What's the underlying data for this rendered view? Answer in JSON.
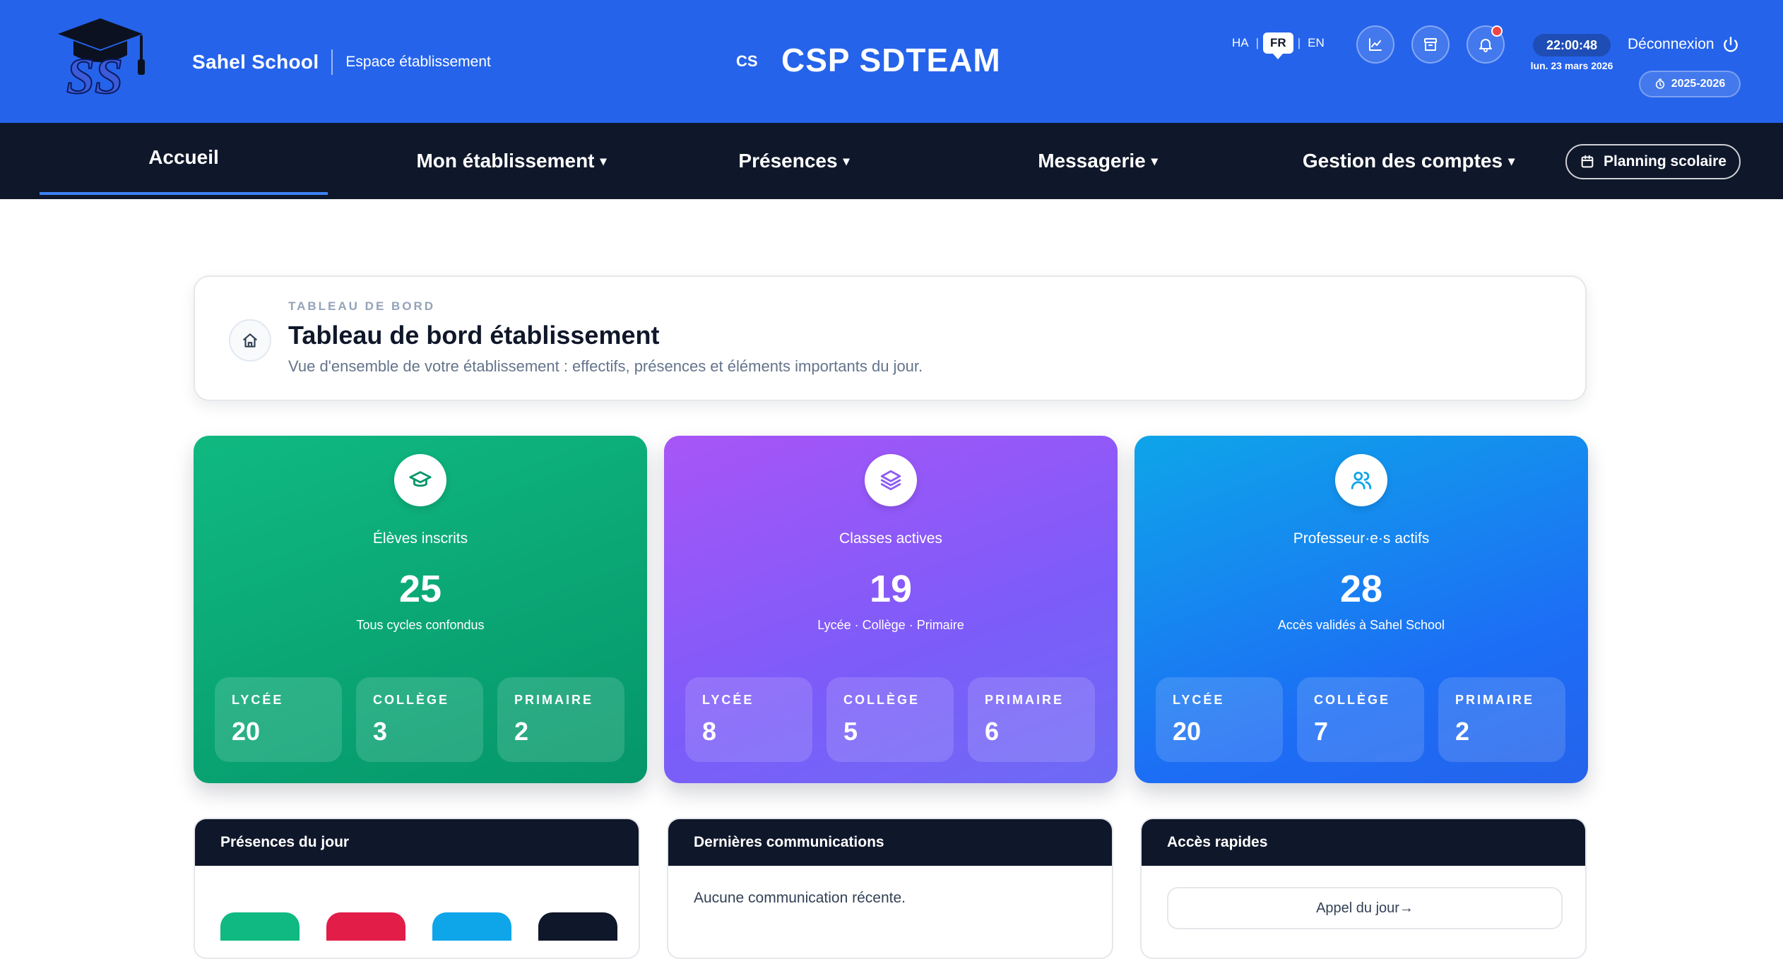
{
  "header": {
    "brand_name": "Sahel School",
    "brand_sub": "Espace établissement",
    "school_code": "CS",
    "school_name": "CSP SDTEAM",
    "languages": [
      "HA",
      "FR",
      "EN"
    ],
    "active_language": "FR",
    "time": "22:00:48",
    "date": "lun. 23 mars 2026",
    "logout_label": "Déconnexion",
    "school_year": "2025-2026",
    "icons": [
      "chart-icon",
      "archive-icon",
      "bell-icon"
    ],
    "has_notification": true
  },
  "nav": {
    "items": [
      {
        "label": "Accueil",
        "active": true,
        "dropdown": false
      },
      {
        "label": "Mon établissement",
        "active": false,
        "dropdown": true
      },
      {
        "label": "Présences",
        "active": false,
        "dropdown": true
      },
      {
        "label": "Messagerie",
        "active": false,
        "dropdown": true
      },
      {
        "label": "Gestion des comptes",
        "active": false,
        "dropdown": true
      }
    ],
    "caret": "▾",
    "planning_label": "Planning scolaire"
  },
  "dashboard": {
    "kicker": "TABLEAU DE BORD",
    "title": "Tableau de bord établissement",
    "description": "Vue d'ensemble de votre établissement : effectifs, présences et éléments importants du jour."
  },
  "stats": [
    {
      "label": "Élèves inscrits",
      "value": "25",
      "note": "Tous cycles confondus",
      "icon": "graduation-cap-icon",
      "color": "#10b981",
      "breakdown": [
        {
          "title": "LYCÉE",
          "value": "20"
        },
        {
          "title": "COLLÈGE",
          "value": "3"
        },
        {
          "title": "PRIMAIRE",
          "value": "2"
        }
      ]
    },
    {
      "label": "Classes actives",
      "value": "19",
      "note": "Lycée · Collège · Primaire",
      "icon": "layers-icon",
      "color": "#a855f7",
      "breakdown": [
        {
          "title": "LYCÉE",
          "value": "8"
        },
        {
          "title": "COLLÈGE",
          "value": "5"
        },
        {
          "title": "PRIMAIRE",
          "value": "6"
        }
      ]
    },
    {
      "label": "Professeur·e·s actifs",
      "value": "28",
      "note": "Accès validés à Sahel School",
      "icon": "users-icon",
      "color": "#0ea5e9",
      "breakdown": [
        {
          "title": "LYCÉE",
          "value": "20"
        },
        {
          "title": "COLLÈGE",
          "value": "7"
        },
        {
          "title": "PRIMAIRE",
          "value": "2"
        }
      ]
    }
  ],
  "panels": {
    "presences": {
      "title": "Présences du jour",
      "pill_colors": [
        "#10b981",
        "#e11d48",
        "#0ea5e9",
        "#0f172a"
      ]
    },
    "communications": {
      "title": "Dernières communications",
      "empty_text": "Aucune communication récente."
    },
    "quick_access": {
      "title": "Accès rapides",
      "first_link": "Appel du jour→"
    }
  }
}
